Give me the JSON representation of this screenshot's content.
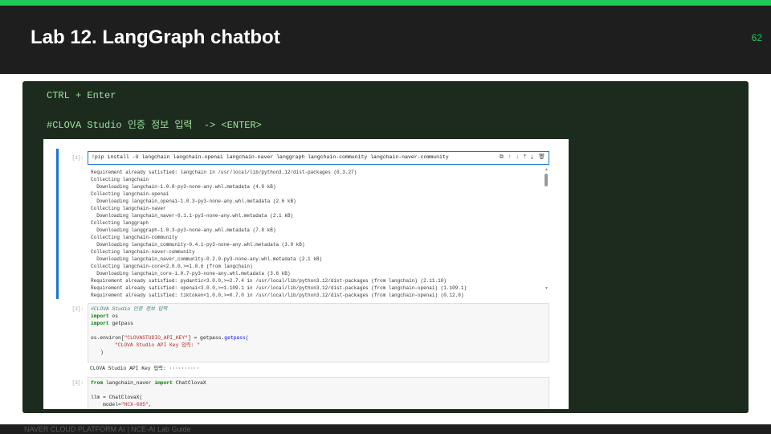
{
  "slide": {
    "title": "Lab 12. LangGraph chatbot",
    "page_number": "62",
    "footer": "NAVER CLOUD PLATFORM AI  |  NCE-AI Lab Guide"
  },
  "instructions": {
    "line1": "CTRL + Enter",
    "line2": "#CLOVA Studio 인증 정보 입력  -> <ENTER>"
  },
  "notebook": {
    "cell1": {
      "prompt": "[1]:",
      "input": "!pip install -U langchain langchain-openai langchain-naver langgraph langchain-community langchain-naver-community",
      "toolbar_icons": [
        "copy-icon",
        "arrow-up-icon",
        "arrow-down-icon",
        "insert-above-icon",
        "insert-below-icon",
        "delete-icon"
      ],
      "output_lines": [
        "Requirement already satisfied: langchain in /usr/local/lib/python3.12/dist-packages (0.3.27)",
        "Collecting langchain",
        "  Downloading langchain-1.0.8-py3-none-any.whl.metadata (4.9 kB)",
        "Collecting langchain-openai",
        "  Downloading langchain_openai-1.0.3-py3-none-any.whl.metadata (2.6 kB)",
        "Collecting langchain-naver",
        "  Downloading langchain_naver-0.1.1-py3-none-any.whl.metadata (2.1 kB)",
        "Collecting langgraph",
        "  Downloading langgraph-1.0.3-py3-none-any.whl.metadata (7.8 kB)",
        "Collecting langchain-community",
        "  Downloading langchain_community-0.4.1-py3-none-any.whl.metadata (3.0 kB)",
        "Collecting langchain-naver-community",
        "  Downloading langchain_naver_community-0.2.0-py3-none-any.whl.metadata (2.1 kB)",
        "Collecting langchain-core<2.0.0,>=1.0.6 (from langchain)",
        "  Downloading langchain_core-1.0.7-py3-none-any.whl.metadata (3.6 kB)",
        "Requirement already satisfied: pydantic<3.0.0,>=2.7.4 in /usr/local/lib/python3.12/dist-packages (from langchain) (2.11.10)",
        "Requirement already satisfied: openai<3.0.0,>=1.109.1 in /usr/local/lib/python3.12/dist-packages (from langchain-openai) (1.109.1)",
        "Requirement already satisfied: tiktoken<1.0.0,>=0.7.0 in /usr/local/lib/python3.12/dist-packages (from langchain-openai) (0.12.0)"
      ]
    },
    "cell2": {
      "prompt": "[2]:",
      "comment": "#CLOVA Studio 인증 정보 입력",
      "kw_import": "import",
      "mod_os": " os",
      "mod_getpass": " getpass",
      "env_prefix": "os.environ[",
      "env_key": "\"CLOVASTUDIO_API_KEY\"",
      "env_mid": "] = getpass.",
      "env_fn": "getpass",
      "env_open": "(",
      "prompt_str": "\"CLOVA Studio API Key 입력: \"",
      "close_paren": ")",
      "output": "CLOVA Studio API Key 입력: ··········"
    },
    "cell3": {
      "prompt": "[3]:",
      "kw_from": "from",
      "mod_from": " langchain_naver ",
      "kw_import": "import",
      "mod_import": " ChatClovaX",
      "llm_line": "llm = ChatClovaX(",
      "model_arg": "    model=",
      "model_val": "\"HCX-005\"",
      "model_tail": ","
    }
  }
}
